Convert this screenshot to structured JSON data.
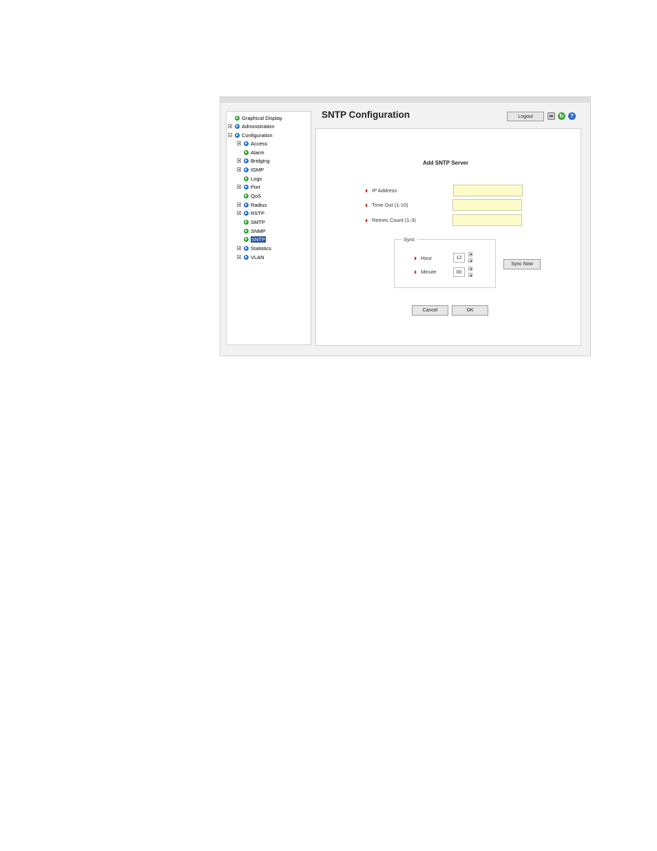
{
  "app": {
    "title": "SNTP Configuration",
    "logout_label": "Logout",
    "icons": [
      "save-icon",
      "refresh-icon",
      "help-icon"
    ]
  },
  "sidebar": {
    "items": [
      {
        "label": "Graphical Display",
        "expander": "none",
        "icon": "green"
      },
      {
        "label": "Administration",
        "expander": "plus",
        "icon": "blue"
      },
      {
        "label": "Configuration",
        "expander": "minus",
        "icon": "blue"
      },
      {
        "label": "Access",
        "expander": "plus",
        "icon": "blue"
      },
      {
        "label": "Alarm",
        "expander": "none",
        "icon": "green"
      },
      {
        "label": "Bridging",
        "expander": "plus",
        "icon": "blue"
      },
      {
        "label": "IGMP",
        "expander": "plus",
        "icon": "blue"
      },
      {
        "label": "Logs",
        "expander": "none",
        "icon": "green"
      },
      {
        "label": "Port",
        "expander": "plus",
        "icon": "blue"
      },
      {
        "label": "QoS",
        "expander": "none",
        "icon": "green"
      },
      {
        "label": "Radius",
        "expander": "plus",
        "icon": "blue"
      },
      {
        "label": "RSTP",
        "expander": "plus",
        "icon": "blue"
      },
      {
        "label": "SMTP",
        "expander": "none",
        "icon": "green"
      },
      {
        "label": "SNMP",
        "expander": "none",
        "icon": "green"
      },
      {
        "label": "SNTP",
        "expander": "none",
        "icon": "green",
        "selected": true
      },
      {
        "label": "Statistics",
        "expander": "plus",
        "icon": "blue"
      },
      {
        "label": "VLAN",
        "expander": "plus",
        "icon": "blue"
      }
    ]
  },
  "form": {
    "section_title": "Add SNTP Server",
    "fields": [
      {
        "label": "IP Address",
        "value": ""
      },
      {
        "label": "Time Out (1-10)",
        "value": ""
      },
      {
        "label": "Retries Count (1-3)",
        "value": ""
      }
    ],
    "sync": {
      "legend": "Sync",
      "hour_label": "Hour",
      "hour_value": "12",
      "minute_label": "Minute",
      "minute_value": "00",
      "sync_now_label": "Sync Now"
    },
    "cancel_label": "Cancel",
    "ok_label": "OK"
  },
  "colors": {
    "input_bg": "#fdfbc8",
    "selected_bg": "#1f4f9e",
    "required_marker": "#c02020"
  }
}
